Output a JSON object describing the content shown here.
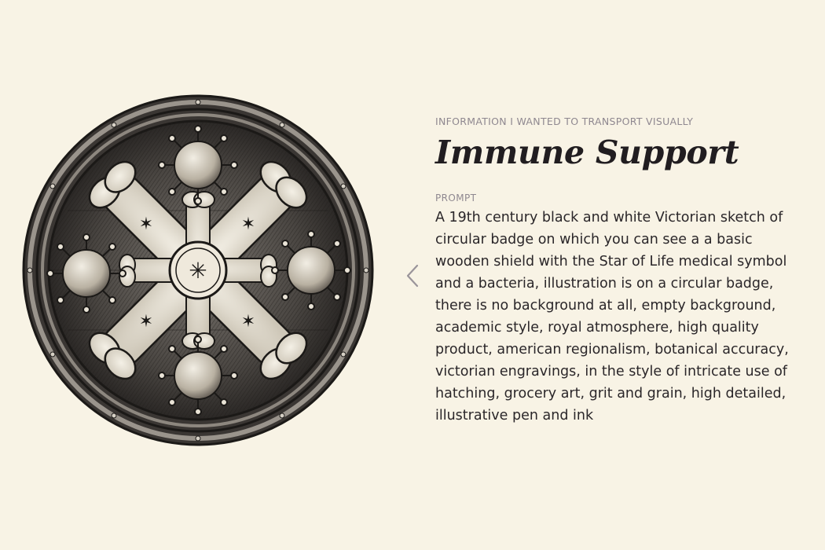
{
  "artwork": {
    "icon": "immune-support-badge",
    "description_visible": false
  },
  "navigation": {
    "previous_icon": "chevron-left-icon"
  },
  "content": {
    "eyebrow": "INFORMATION I WANTED TO TRANSPORT VISUALLY",
    "title": "Immune Support",
    "prompt_label": "PROMPT",
    "prompt_text": "A 19th century black and white Victorian sketch of circular badge on which you can see a a basic wooden shield with the Star of Life medical symbol and a bacteria, illustration is on a circular badge, there is no background at all, empty background, academic style, royal atmosphere, high quality product, american regionalism, botanical accuracy, victorian engravings, in the style of intricate use of hatching, grocery art, grit and grain, high detailed, illustrative pen and ink"
  },
  "colors": {
    "background": "#f8f3e5",
    "ink": "#211d20",
    "muted": "#8f8890"
  }
}
